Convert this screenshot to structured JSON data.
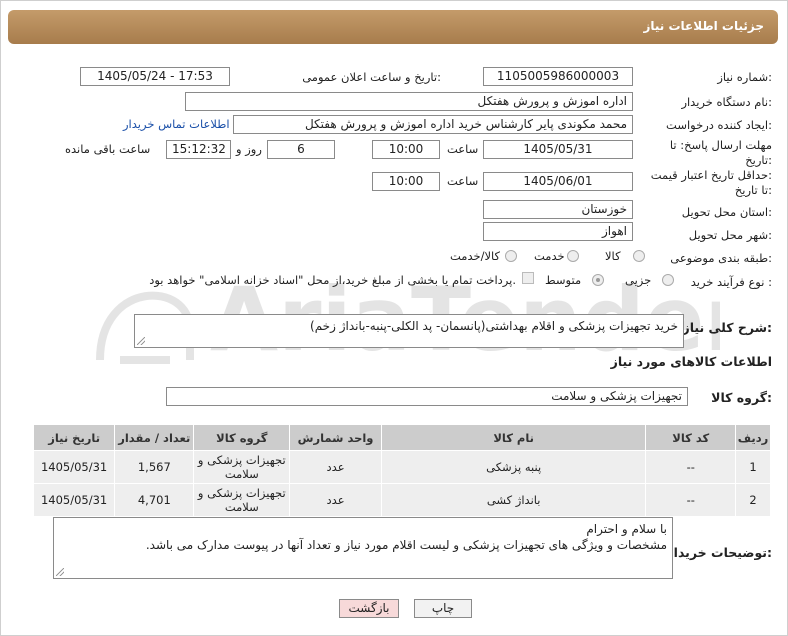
{
  "header": {
    "title": "جزئیات اطلاعات نیاز"
  },
  "form": {
    "need_number_label": "شماره نیاز:",
    "need_number": "1105005986000003",
    "announce_label": "تاریخ و ساعت اعلان عمومی:",
    "announce_value": "1405/05/24 - 17:53",
    "buyer_org_label": "نام دستگاه خریدار:",
    "buyer_org": "اداره اموزش و پرورش هفتکل",
    "creator_label": "ایجاد کننده درخواست:",
    "creator": "محمد مکوندی پایر کارشناس خرید اداره اموزش و پرورش هفتکل",
    "contact_link": "اطلاعات تماس خریدار",
    "reply_deadline_label_1": "مهلت ارسال پاسخ: تا",
    "reply_deadline_label_2": "تاریخ:",
    "reply_date": "1405/05/31",
    "time_label": "ساعت",
    "reply_time": "10:00",
    "days_count": "6",
    "days_label": "روز و",
    "remaining_time": "15:12:32",
    "remaining_label": "ساعت باقی مانده",
    "validity_label_1": "حداقل تاریخ اعتبار قیمت:",
    "validity_label_2": "تا تاریخ:",
    "validity_date": "1405/06/01",
    "validity_time": "10:00",
    "province_label": "استان محل تحویل:",
    "province": "خوزستان",
    "city_label": "شهر محل تحویل:",
    "city": "اهواز",
    "category_label": "طبقه بندی موضوعی:",
    "category_options": [
      "کالا",
      "خدمت",
      "کالا/خدمت"
    ],
    "process_label": "نوع فرآیند خرید :",
    "process_options": [
      "جزیی",
      "متوسط"
    ],
    "payment_note": "پرداخت تمام یا بخشی از مبلغ خرید،از محل \"اسناد خزانه اسلامی\" خواهد بود."
  },
  "general_desc": {
    "label": "شرح کلی نیاز:",
    "value": "خرید تجهیزات پزشکی و اقلام بهداشتی(پانسمان- پد الکلی-پنبه-بانداژ زخم)"
  },
  "goods_info_title": "اطلاعات کالاهای مورد نیاز",
  "goods_group": {
    "label": "گروه کالا:",
    "value": "تجهیزات پزشکی و سلامت"
  },
  "table": {
    "headers": [
      "ردیف",
      "کد کالا",
      "نام کالا",
      "واحد شمارش",
      "گروه کالا",
      "تعداد / مقدار",
      "تاریخ نیاز"
    ],
    "rows": [
      [
        "1",
        "--",
        "پنبه پزشکی",
        "عدد",
        "تجهیزات پزشکی و سلامت",
        "1,567",
        "1405/05/31"
      ],
      [
        "2",
        "--",
        "بانداژ کشی",
        "عدد",
        "تجهیزات پزشکی و سلامت",
        "4,701",
        "1405/05/31"
      ]
    ]
  },
  "buyer_notes": {
    "label": "توضیحات خریدار:",
    "line1": "با سلام و احترام",
    "line2": "مشخصات و ویژگی های تجهیزات پزشکی و لیست اقلام مورد نیاز و تعداد آنها در پیوست مدارک می باشد."
  },
  "buttons": {
    "print": "چاپ",
    "back": "بازگشت"
  },
  "watermark_text": "AriaTender.neT",
  "colors": {
    "header": "#b38a5a",
    "link": "#1a4fa8",
    "table_header": "#cccccc",
    "table_row": "#eeeeee",
    "back_button": "#f7d9d9"
  }
}
